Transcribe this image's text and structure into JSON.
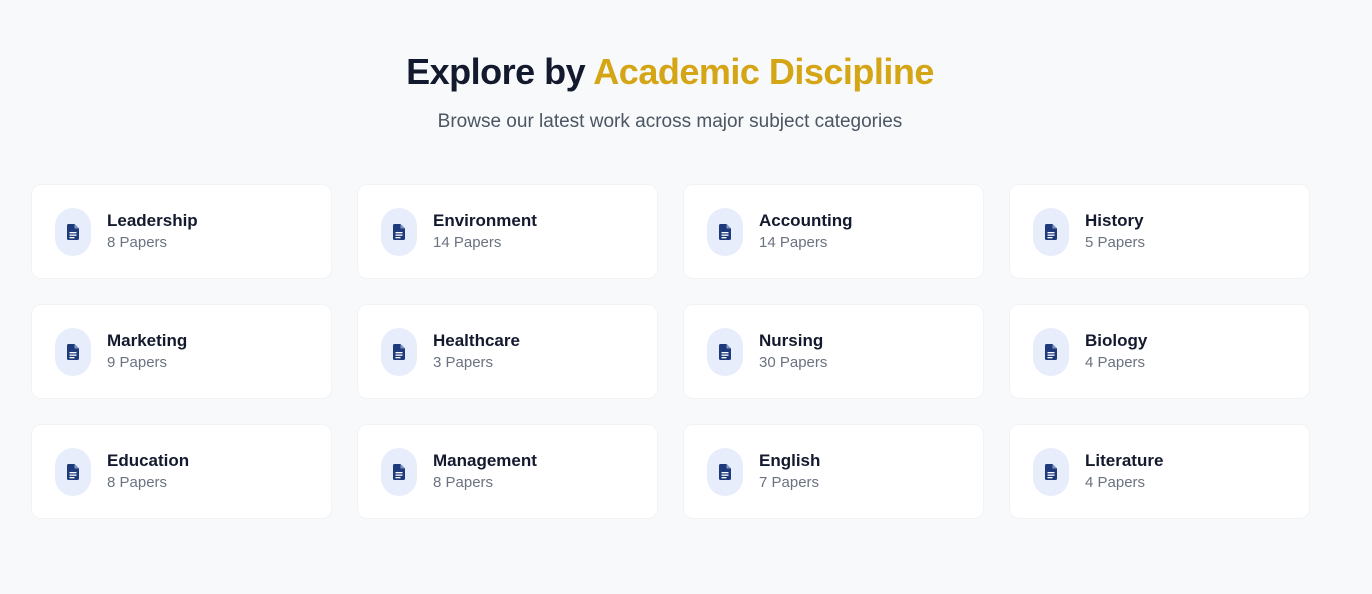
{
  "header": {
    "title_prefix": "Explore by",
    "title_accent": "Academic Discipline",
    "subtitle": "Browse our latest work across major subject categories"
  },
  "colors": {
    "accent": "#d4a514",
    "title": "#141a2e",
    "icon": "#1e3a7b",
    "icon_bg": "#e7edfb"
  },
  "icon_name": "document-icon",
  "categories": [
    {
      "name": "Leadership",
      "count": "8 Papers"
    },
    {
      "name": "Environment",
      "count": "14 Papers"
    },
    {
      "name": "Accounting",
      "count": "14 Papers"
    },
    {
      "name": "History",
      "count": "5 Papers"
    },
    {
      "name": "Marketing",
      "count": "9 Papers"
    },
    {
      "name": "Healthcare",
      "count": "3 Papers"
    },
    {
      "name": "Nursing",
      "count": "30 Papers"
    },
    {
      "name": "Biology",
      "count": "4 Papers"
    },
    {
      "name": "Education",
      "count": "8 Papers"
    },
    {
      "name": "Management",
      "count": "8 Papers"
    },
    {
      "name": "English",
      "count": "7 Papers"
    },
    {
      "name": "Literature",
      "count": "4 Papers"
    }
  ]
}
